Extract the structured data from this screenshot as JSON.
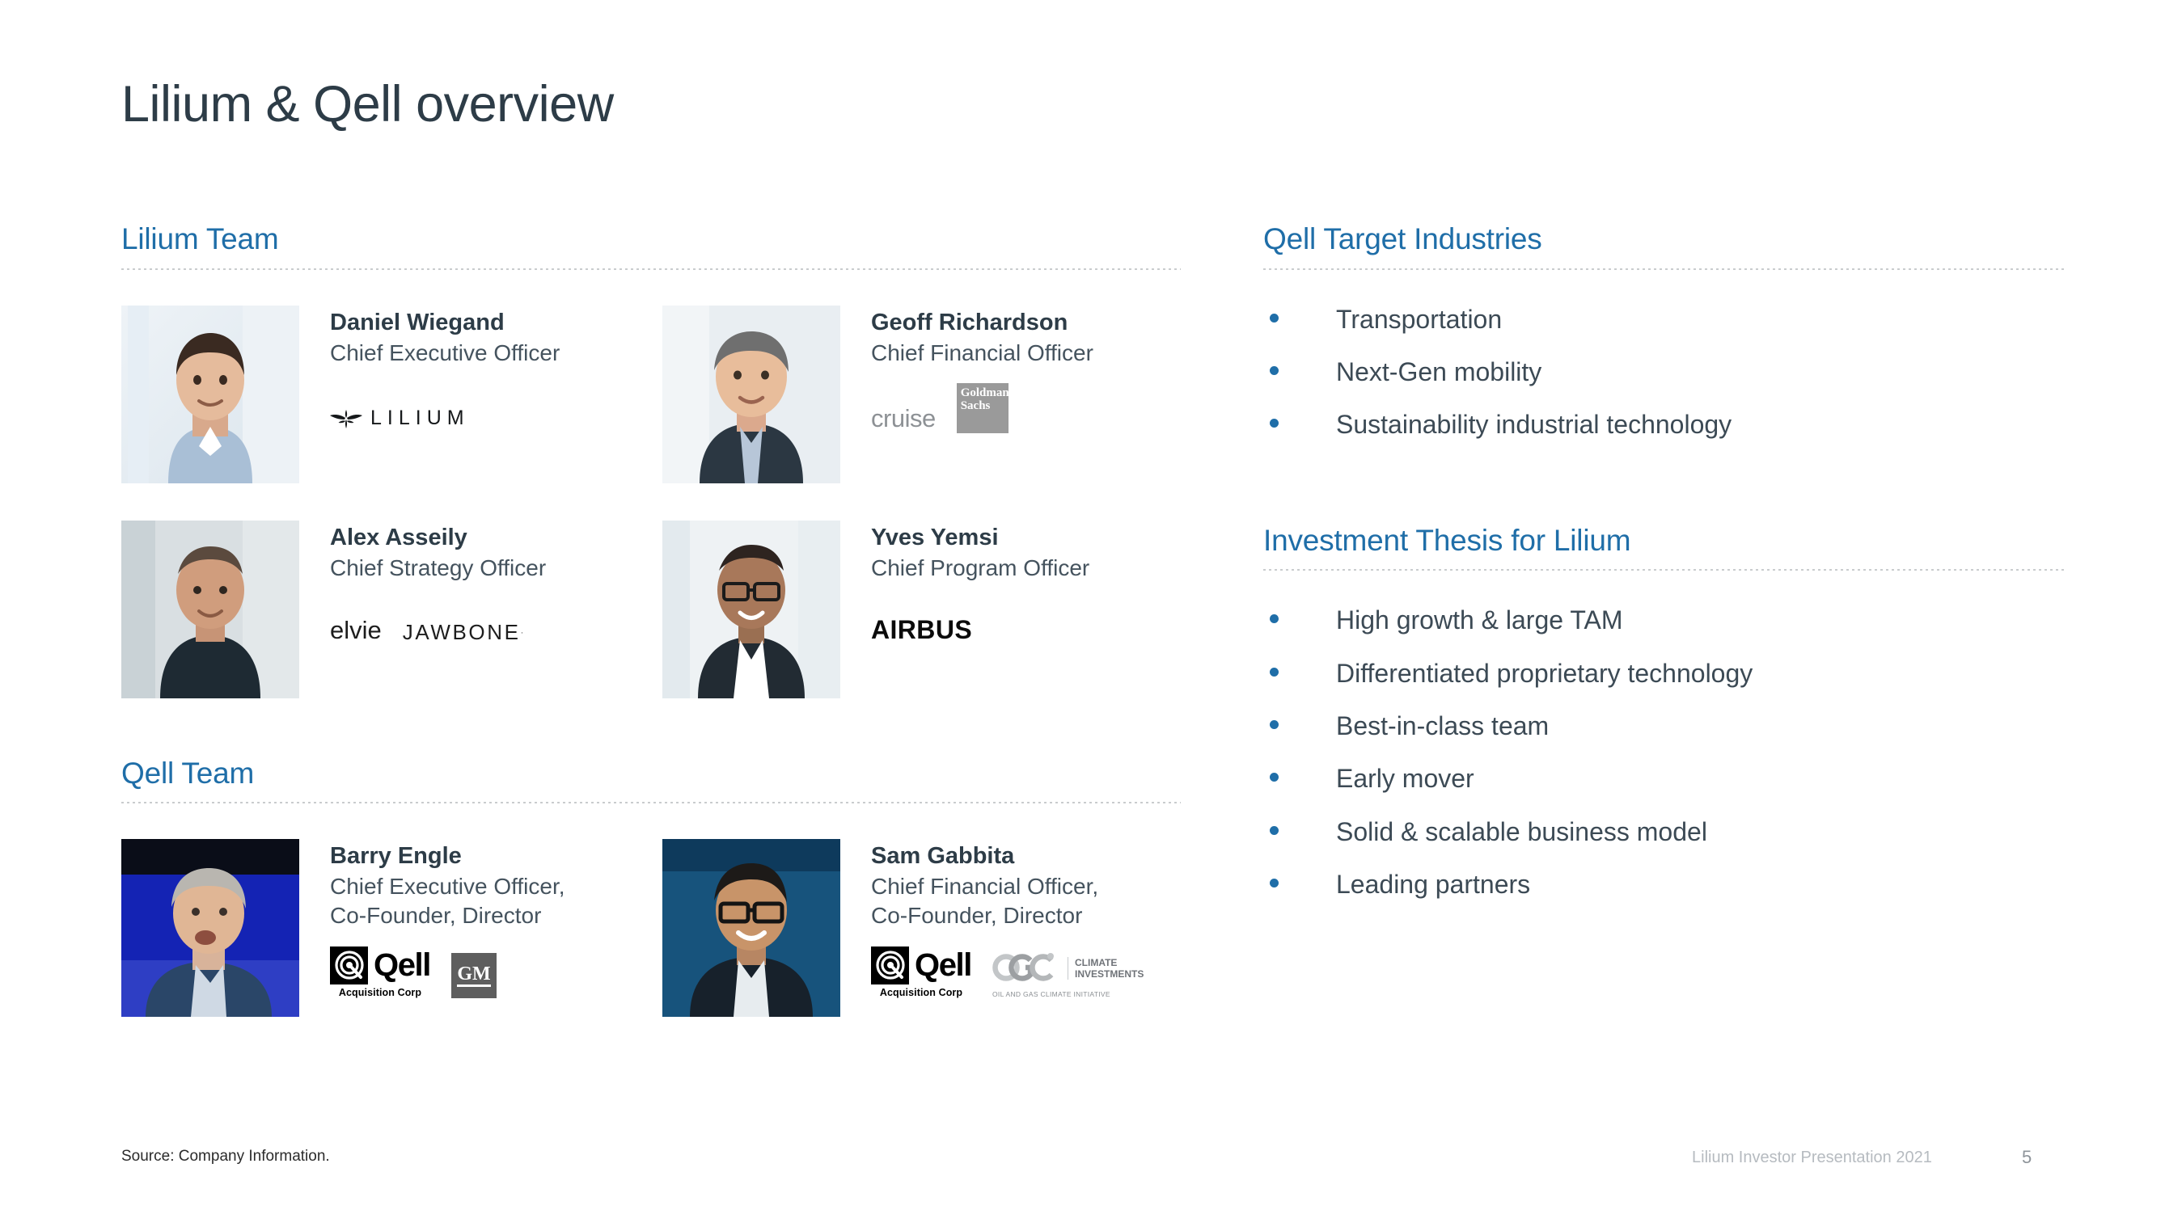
{
  "slide": {
    "title": "Lilium & Qell overview",
    "accent_blue": "#1F6EA8",
    "title_color": "#2D3C47"
  },
  "left_column": {
    "lilium_team": {
      "heading": "Lilium Team",
      "people": [
        {
          "name": "Daniel Wiegand",
          "title": "Chief Executive Officer",
          "logos": [
            "lilium"
          ]
        },
        {
          "name": "Geoff Richardson",
          "title": "Chief Financial Officer",
          "logos": [
            "cruise",
            "goldman-sachs"
          ]
        },
        {
          "name": "Alex Asseily",
          "title": "Chief Strategy Officer",
          "logos": [
            "elvie",
            "jawbone"
          ]
        },
        {
          "name": "Yves Yemsi",
          "title": "Chief Program Officer",
          "logos": [
            "airbus"
          ]
        }
      ]
    },
    "qell_team": {
      "heading": "Qell Team",
      "people": [
        {
          "name": "Barry Engle",
          "title": "Chief Executive Officer,\nCo-Founder, Director",
          "logos": [
            "qell",
            "gm"
          ]
        },
        {
          "name": "Sam Gabbita",
          "title": "Chief Financial Officer,\nCo-Founder, Director",
          "logos": [
            "qell",
            "ogci"
          ]
        }
      ]
    }
  },
  "right_column": {
    "target_industries": {
      "heading": "Qell Target Industries",
      "bullets": [
        "Transportation",
        "Next-Gen mobility",
        "Sustainability industrial technology"
      ]
    },
    "investment_thesis": {
      "heading": "Investment Thesis for Lilium",
      "bullets": [
        "High growth & large TAM",
        "Differentiated proprietary technology",
        "Best-in-class team",
        "Early mover",
        "Solid & scalable business model",
        "Leading partners"
      ]
    }
  },
  "logos": {
    "lilium": {
      "wordmark": "LILIUM"
    },
    "cruise": {
      "wordmark": "cruise"
    },
    "goldman_sachs": {
      "line1": "Goldman",
      "line2": "Sachs"
    },
    "elvie": {
      "wordmark": "elvie"
    },
    "jawbone": {
      "wordmark": "JAWBONE"
    },
    "airbus": {
      "wordmark": "AIRBUS"
    },
    "qell": {
      "wordmark": "Qell",
      "subtitle": "Acquisition Corp"
    },
    "gm": {
      "wordmark": "GM"
    },
    "ogci": {
      "text": "CLIMATE\nINVESTMENTS",
      "subtitle": "OIL AND GAS CLIMATE INITIATIVE"
    }
  },
  "footer": {
    "source": "Source: Company Information.",
    "deck_name": "Lilium Investor Presentation 2021",
    "page_number": "5"
  }
}
